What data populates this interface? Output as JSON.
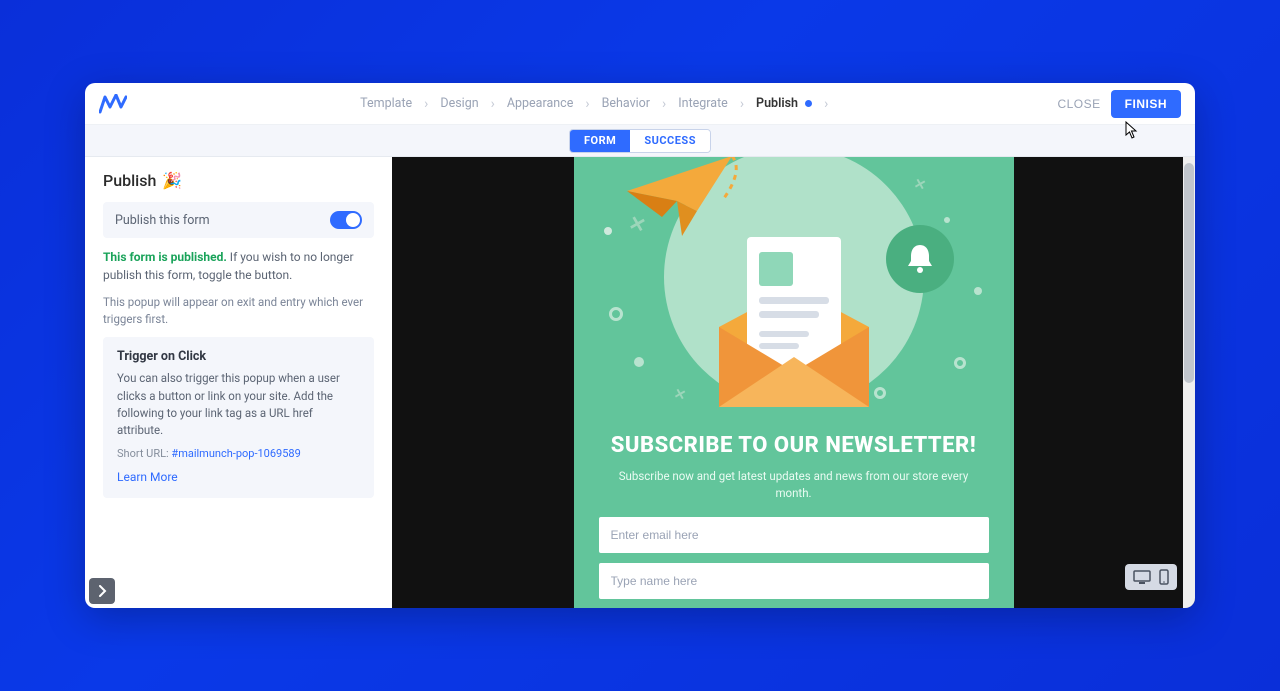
{
  "header": {
    "breadcrumbs": [
      {
        "label": "Template",
        "active": false
      },
      {
        "label": "Design",
        "active": false
      },
      {
        "label": "Appearance",
        "active": false
      },
      {
        "label": "Behavior",
        "active": false
      },
      {
        "label": "Integrate",
        "active": false
      },
      {
        "label": "Publish",
        "active": true
      }
    ],
    "close_label": "CLOSE",
    "finish_label": "FINISH"
  },
  "subtabs": {
    "form_label": "FORM",
    "success_label": "SUCCESS",
    "active": "form"
  },
  "sidebar": {
    "title": "Publish",
    "title_emoji": "🎉",
    "toggle_label": "Publish this form",
    "toggle_on": true,
    "status_bold": "This form is published.",
    "status_rest": " If you wish to no longer publish this form, toggle the button.",
    "behavior_text": "This popup will appear on exit and entry which ever triggers first.",
    "trigger_box": {
      "heading": "Trigger on Click",
      "body": "You can also trigger this popup when a user clicks a button or link on your site. Add the following to your link tag as a URL href attribute.",
      "short_url_label": "Short URL:",
      "short_url_value": "#mailmunch-pop-1069589",
      "learn_more": "Learn More"
    }
  },
  "preview": {
    "title": "SUBSCRIBE TO OUR NEWSLETTER!",
    "subtitle": "Subscribe now and get latest updates and news from our store every month.",
    "email_placeholder": "Enter email here",
    "name_placeholder": "Type name here"
  },
  "colors": {
    "primary": "#2f6bff",
    "green_card": "#62c59b"
  }
}
